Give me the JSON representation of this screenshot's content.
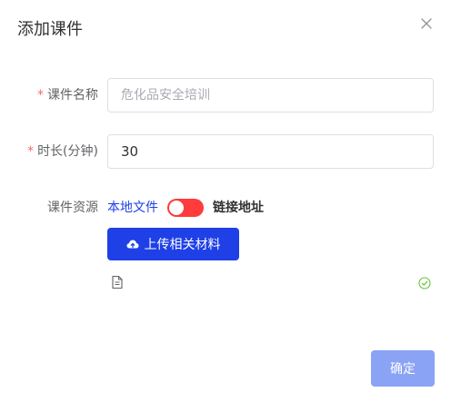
{
  "dialog": {
    "title": "添加课件"
  },
  "form": {
    "required_mark": "*",
    "name": {
      "label": "课件名称",
      "placeholder": "危化品安全培训",
      "value": ""
    },
    "duration": {
      "label": "时长(分钟)",
      "value": "30"
    },
    "resource": {
      "label": "课件资源",
      "option_local": "本地文件",
      "option_link": "链接地址",
      "switch_on": true,
      "upload_label": "上传相关材料"
    }
  },
  "footer": {
    "confirm_label": "确定"
  },
  "colors": {
    "primary": "#1e40e6",
    "switch": "#ff3b3b",
    "required": "#f56c6c",
    "confirm_disabled": "#8aa3f5",
    "success": "#67c23a"
  },
  "icons": {
    "close": "close-icon",
    "upload": "cloud-upload-icon",
    "file": "document-icon",
    "success": "check-circle-icon"
  }
}
